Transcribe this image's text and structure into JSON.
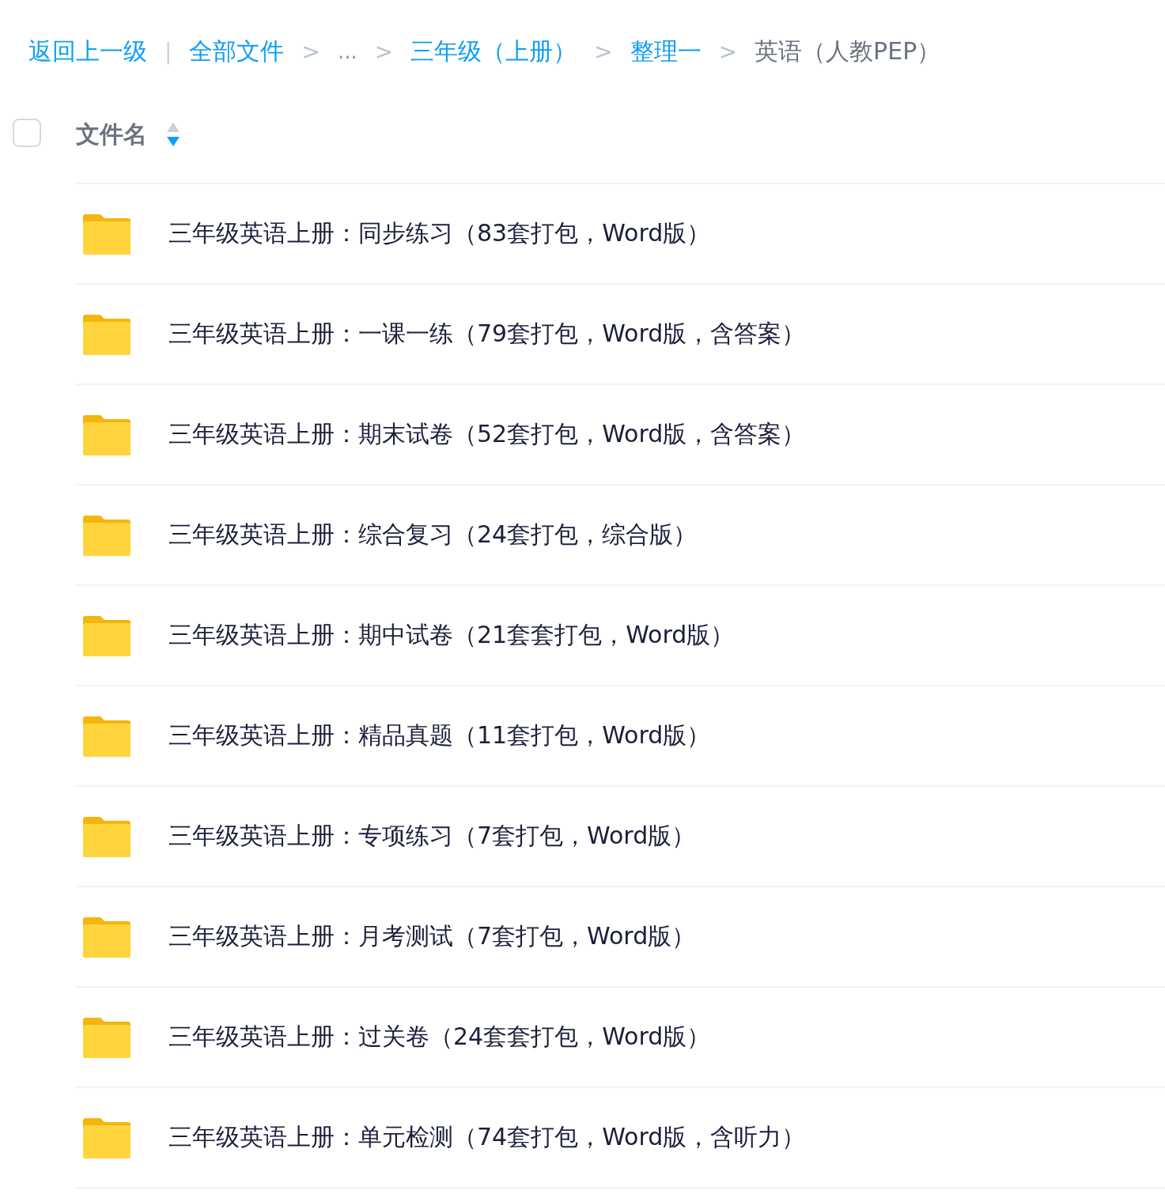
{
  "breadcrumb": [
    {
      "kind": "link",
      "label": "返回上一级"
    },
    {
      "kind": "divider",
      "label": "|"
    },
    {
      "kind": "link",
      "label": "全部文件"
    },
    {
      "kind": "chevron",
      "label": ">"
    },
    {
      "kind": "ellipsis",
      "label": "..."
    },
    {
      "kind": "chevron",
      "label": ">"
    },
    {
      "kind": "link",
      "label": "三年级（上册）"
    },
    {
      "kind": "chevron",
      "label": ">"
    },
    {
      "kind": "link",
      "label": "整理一"
    },
    {
      "kind": "chevron",
      "label": ">"
    },
    {
      "kind": "current",
      "label": "英语（人教PEP）"
    }
  ],
  "header": {
    "select_all": {
      "checked": false
    },
    "column": "文件名",
    "sort_descending": true
  },
  "rows": [
    {
      "name": "三年级英语上册：同步练习（83套打包，Word版）"
    },
    {
      "name": "三年级英语上册：一课一练（79套打包，Word版，含答案）"
    },
    {
      "name": "三年级英语上册：期末试卷（52套打包，Word版，含答案）"
    },
    {
      "name": "三年级英语上册：综合复习（24套打包，综合版）"
    },
    {
      "name": "三年级英语上册：期中试卷（21套套打包，Word版）"
    },
    {
      "name": "三年级英语上册：精品真题（11套打包，Word版）"
    },
    {
      "name": "三年级英语上册：专项练习（7套打包，Word版）"
    },
    {
      "name": "三年级英语上册：月考测试（7套打包，Word版）"
    },
    {
      "name": "三年级英语上册：过关卷（24套套打包，Word版）"
    },
    {
      "name": "三年级英语上册：单元检测（74套打包，Word版，含听力）"
    }
  ]
}
